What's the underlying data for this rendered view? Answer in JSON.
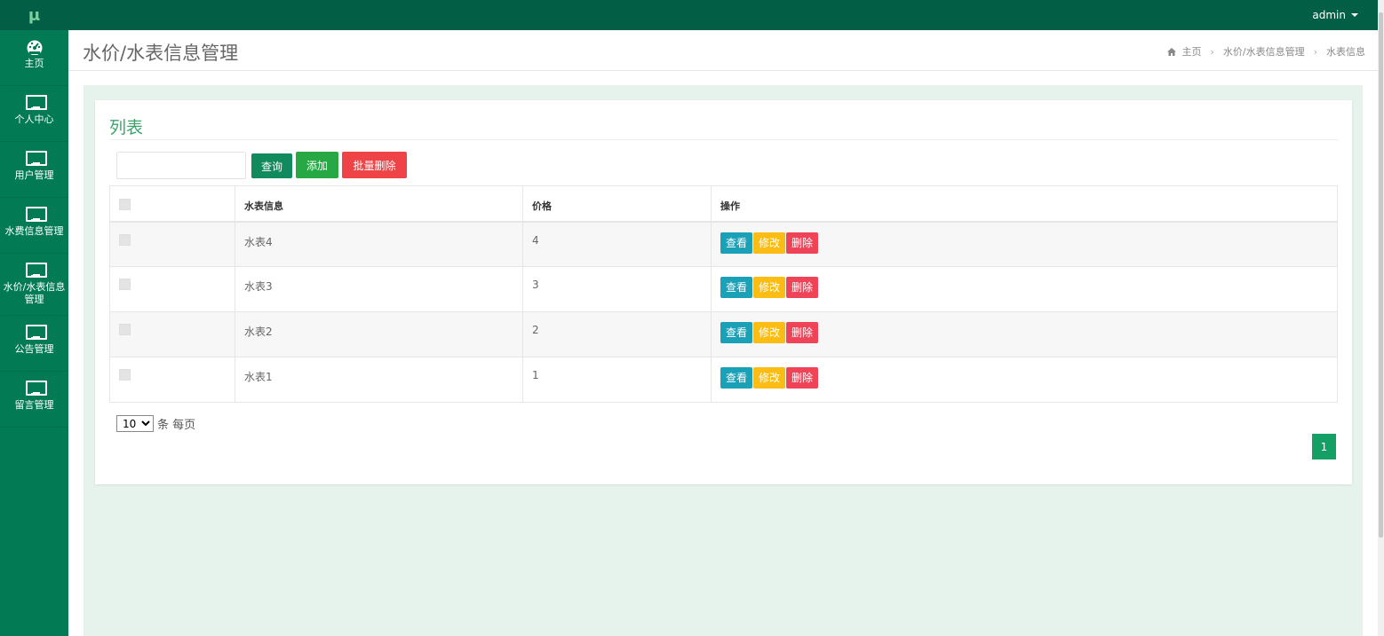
{
  "app": {
    "logo": "μ",
    "user": "admin"
  },
  "sidebar": {
    "items": [
      {
        "label": "主页",
        "icon": "dashboard-icon"
      },
      {
        "label": "个人中心",
        "icon": "monitor-icon"
      },
      {
        "label": "用户管理",
        "icon": "monitor-icon"
      },
      {
        "label": "水费信息管理",
        "icon": "monitor-icon"
      },
      {
        "label": "水价/水表信息管理",
        "icon": "monitor-icon"
      },
      {
        "label": "公告管理",
        "icon": "monitor-icon"
      },
      {
        "label": "留言管理",
        "icon": "monitor-icon"
      }
    ]
  },
  "header": {
    "title": "水价/水表信息管理",
    "breadcrumb": [
      "主页",
      "水价/水表信息管理",
      "水表信息"
    ]
  },
  "card": {
    "title": "列表",
    "search": {
      "value": "",
      "placeholder": ""
    },
    "buttons": {
      "query": "查询",
      "add": "添加",
      "batch_delete": "批量删除"
    }
  },
  "table": {
    "columns": [
      "",
      "水表信息",
      "价格",
      "操作"
    ],
    "rows": [
      {
        "name": "水表4",
        "price": "4"
      },
      {
        "name": "水表3",
        "price": "3"
      },
      {
        "name": "水表2",
        "price": "2"
      },
      {
        "name": "水表1",
        "price": "1"
      }
    ],
    "ops": {
      "view": "查看",
      "edit": "修改",
      "delete": "删除"
    }
  },
  "pagination": {
    "page_size": "10",
    "page_size_suffix": "条 每页",
    "current_page": "1"
  },
  "colors": {
    "topbar": "#025e44",
    "sidebar": "#027a54",
    "accent": "#3aa56b",
    "view": "#1aa0b7",
    "edit": "#fbbd14",
    "delete": "#ef4458"
  }
}
